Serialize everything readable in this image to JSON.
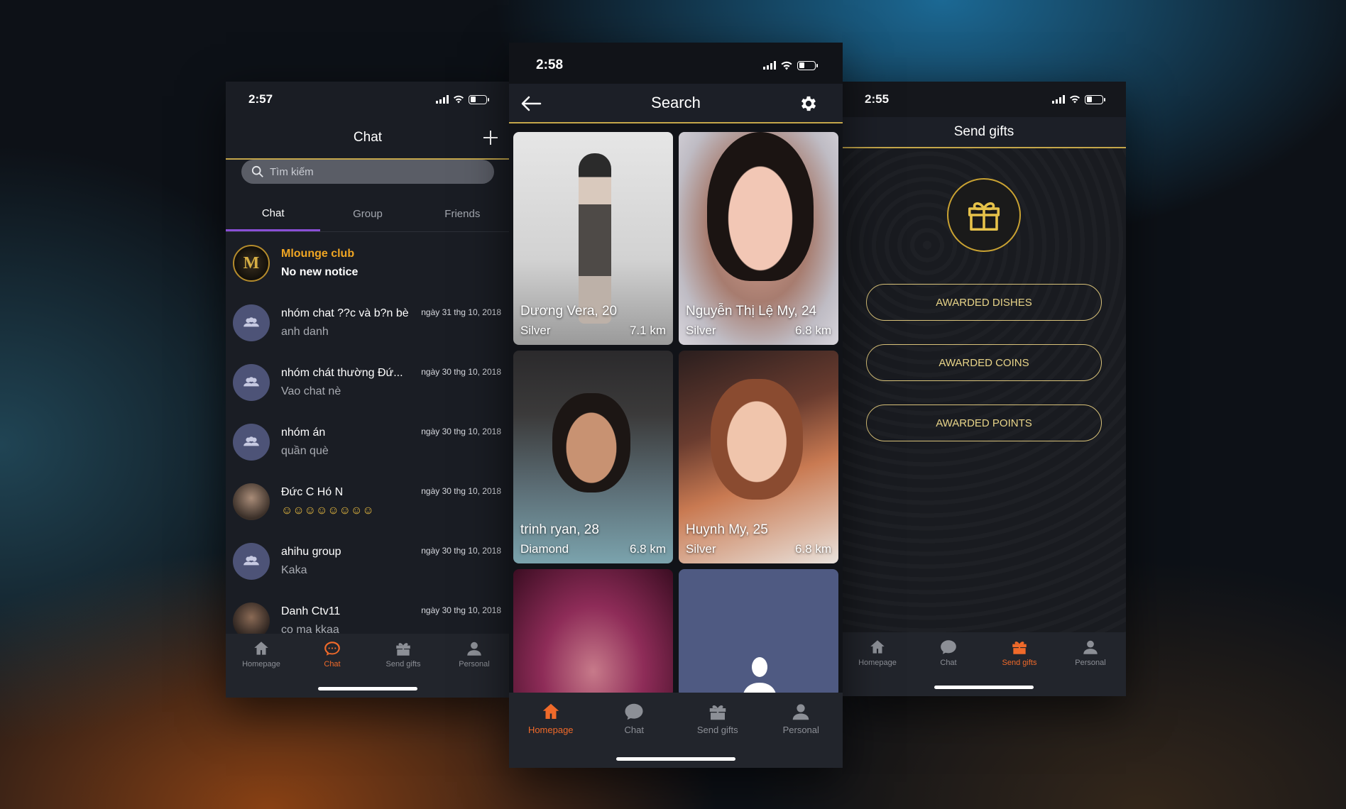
{
  "chat_screen": {
    "time": "2:57",
    "title": "Chat",
    "search_placeholder": "Tìm kiếm",
    "tabs": [
      "Chat",
      "Group",
      "Friends"
    ],
    "items": [
      {
        "name": "Mlounge club",
        "message": "No new notice",
        "date": "",
        "avatar": "club-logo",
        "avatar_text": "M"
      },
      {
        "name": "nhóm chat ??c và b?n bè",
        "message": "anh danh",
        "date": "ngày 31 thg 10, 2018",
        "avatar": "group-icon"
      },
      {
        "name": "nhóm chát thường Đứ...",
        "message": "Vao chat nè",
        "date": "ngày 30 thg 10, 2018",
        "avatar": "group-icon"
      },
      {
        "name": "nhóm án",
        "message": "quần què",
        "date": "ngày 30 thg 10, 2018",
        "avatar": "group-icon"
      },
      {
        "name": "Đức C Hó N",
        "message": "☺☺☺☺☺☺☺☺",
        "date": "ngày 30 thg 10, 2018",
        "avatar": "photo"
      },
      {
        "name": "ahihu group",
        "message": "Kaka",
        "date": "ngày 30 thg 10, 2018",
        "avatar": "group-icon"
      },
      {
        "name": "Danh Ctv11",
        "message": "co ma kkaa",
        "date": "ngày 30 thg 10, 2018",
        "avatar": "photo"
      }
    ]
  },
  "search_screen": {
    "time": "2:58",
    "title": "Search",
    "cards": [
      {
        "name": "Dương Vera, 20",
        "level": "Silver",
        "distance": "7.1 km"
      },
      {
        "name": "Nguyễn Thị Lệ My, 24",
        "level": "Silver",
        "distance": "6.8 km"
      },
      {
        "name": "trinh ryan, 28",
        "level": "Diamond",
        "distance": "6.8 km"
      },
      {
        "name": "Huynh My, 25",
        "level": "Silver",
        "distance": "6.8 km"
      },
      {
        "name": "",
        "level": "",
        "distance": ""
      },
      {
        "name": "",
        "level": "",
        "distance": ""
      }
    ]
  },
  "gifts_screen": {
    "time": "2:55",
    "title": "Send gifts",
    "buttons": [
      "AWARDED DISHES",
      "AWARDED COINS",
      "AWARDED POINTS"
    ]
  },
  "tabbar": {
    "labels": [
      "Homepage",
      "Chat",
      "Send gifts",
      "Personal"
    ],
    "icons": [
      "home-icon",
      "chat-bubble-icon",
      "gift-icon",
      "person-icon"
    ]
  },
  "colors": {
    "accent_orange": "#f06a2a",
    "gold": "#c4a64a",
    "club_name": "#f0a623",
    "tab_indicator": "#8a4fd6"
  }
}
